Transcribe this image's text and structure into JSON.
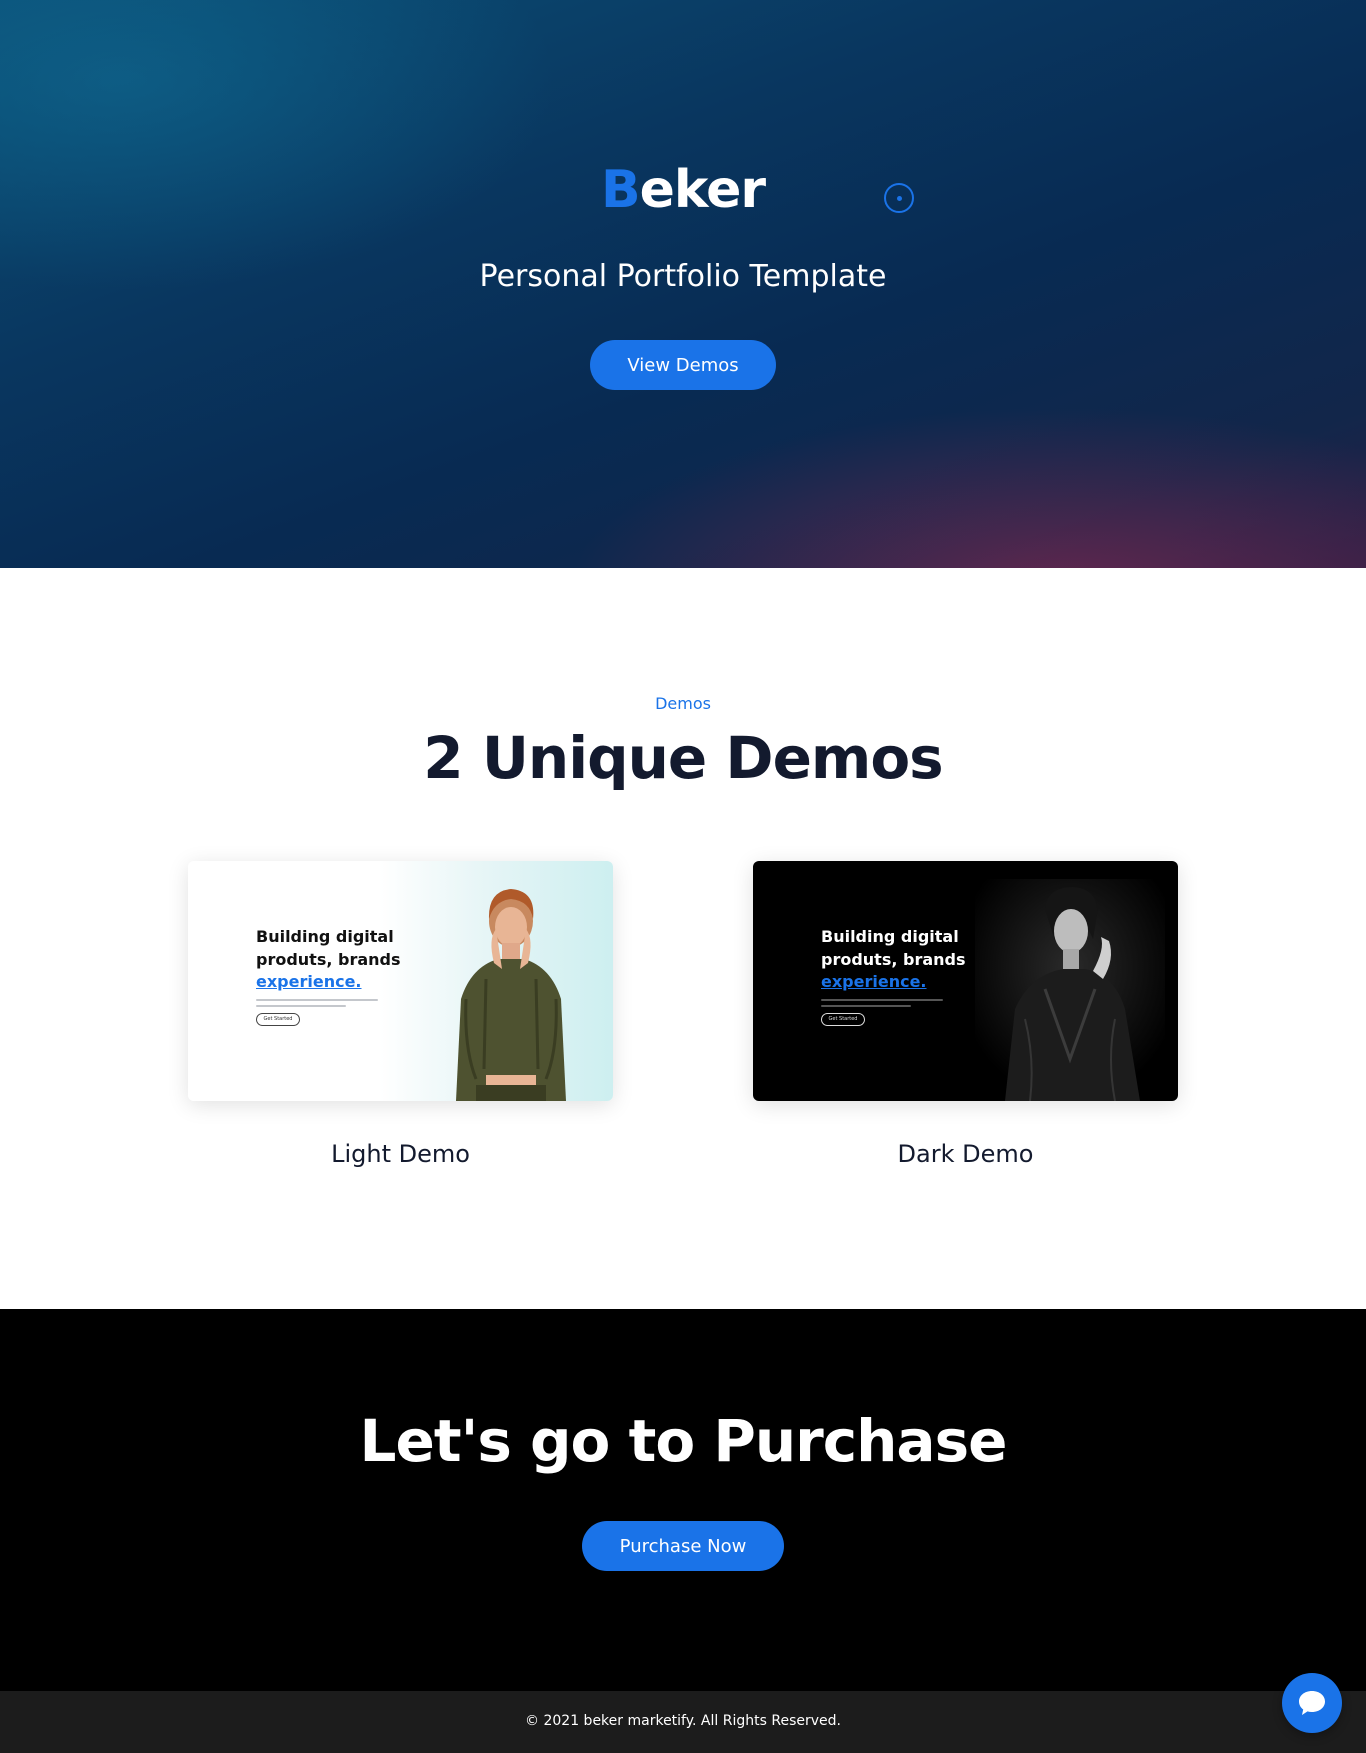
{
  "hero": {
    "logo_accent": "B",
    "logo_rest": "eker",
    "subtitle": "Personal Portfolio Template",
    "cta_label": "View Demos"
  },
  "demos": {
    "kicker": "Demos",
    "title": "2 Unique Demos",
    "cards": [
      {
        "label": "Light Demo",
        "preview_heading_line1": "Building digital",
        "preview_heading_line2": "produts, brands",
        "preview_accent": "experience.",
        "preview_button": "Get Started"
      },
      {
        "label": "Dark Demo",
        "preview_heading_line1": "Building digital",
        "preview_heading_line2": "produts, brands",
        "preview_accent": "experience.",
        "preview_button": "Get Started"
      }
    ]
  },
  "purchase": {
    "title": "Let's go to Purchase",
    "cta_label": "Purchase Now"
  },
  "footer": {
    "copyright": "© 2021 beker marketify. All Rights Reserved."
  },
  "icons": {
    "hero_target": "target-circle-icon",
    "chat": "chat-bubble-icon"
  },
  "colors": {
    "accent": "#1a73e8",
    "heading": "#131a2e",
    "purchase_bg": "#000000",
    "footer_bg": "#1c1c1c"
  }
}
